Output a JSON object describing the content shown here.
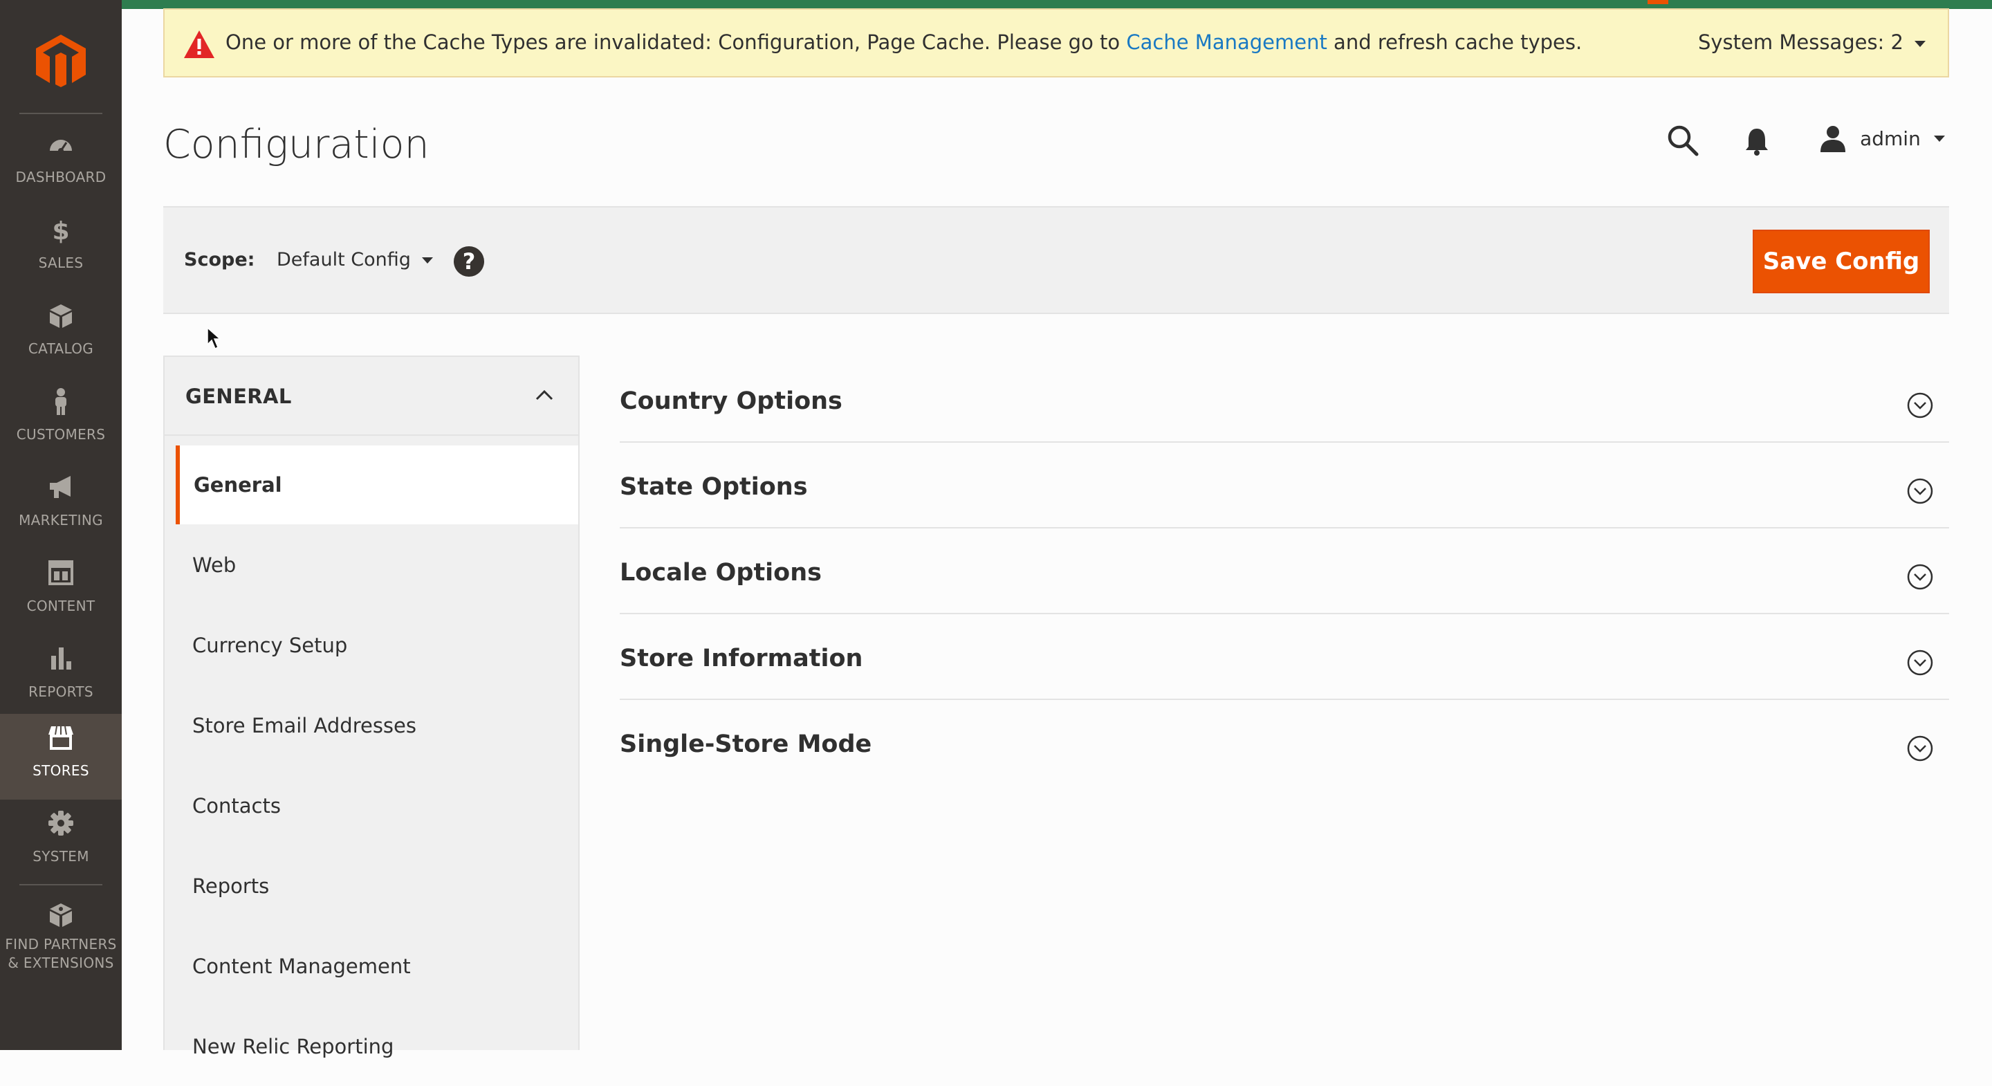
{
  "sidebar": {
    "items": [
      {
        "label": "DASHBOARD",
        "icon": "dashboard-icon"
      },
      {
        "label": "SALES",
        "icon": "dollar-icon"
      },
      {
        "label": "CATALOG",
        "icon": "box-icon"
      },
      {
        "label": "CUSTOMERS",
        "icon": "person-icon"
      },
      {
        "label": "MARKETING",
        "icon": "megaphone-icon"
      },
      {
        "label": "CONTENT",
        "icon": "layout-icon"
      },
      {
        "label": "REPORTS",
        "icon": "bar-chart-icon"
      },
      {
        "label": "STORES",
        "icon": "storefront-icon",
        "active": true
      },
      {
        "label": "SYSTEM",
        "icon": "gear-icon"
      },
      {
        "label_line1": "FIND PARTNERS",
        "label_line2": "& EXTENSIONS",
        "icon": "extensions-icon"
      }
    ]
  },
  "system_message": {
    "text_before": "One or more of the Cache Types are invalidated: Configuration, Page Cache. Please go to ",
    "link": "Cache Management",
    "text_after": " and refresh cache types.",
    "counter": "System Messages: 2"
  },
  "header": {
    "title": "Configuration",
    "user": "admin"
  },
  "scope": {
    "label": "Scope:",
    "value": "Default Config",
    "save_label": "Save Config"
  },
  "tabs": {
    "group_title": "GENERAL",
    "items": [
      {
        "label": "General",
        "active": true
      },
      {
        "label": "Web"
      },
      {
        "label": "Currency Setup"
      },
      {
        "label": "Store Email Addresses"
      },
      {
        "label": "Contacts"
      },
      {
        "label": "Reports"
      },
      {
        "label": "Content Management"
      },
      {
        "label": "New Relic Reporting"
      }
    ]
  },
  "sections": [
    {
      "title": "Country Options"
    },
    {
      "title": "State Options"
    },
    {
      "title": "Locale Options"
    },
    {
      "title": "Store Information"
    },
    {
      "title": "Single-Store Mode"
    }
  ],
  "colors": {
    "accent": "#eb5202",
    "sidebar_bg": "#373330",
    "link": "#1979c3",
    "message_bg": "#fbf6c4"
  }
}
